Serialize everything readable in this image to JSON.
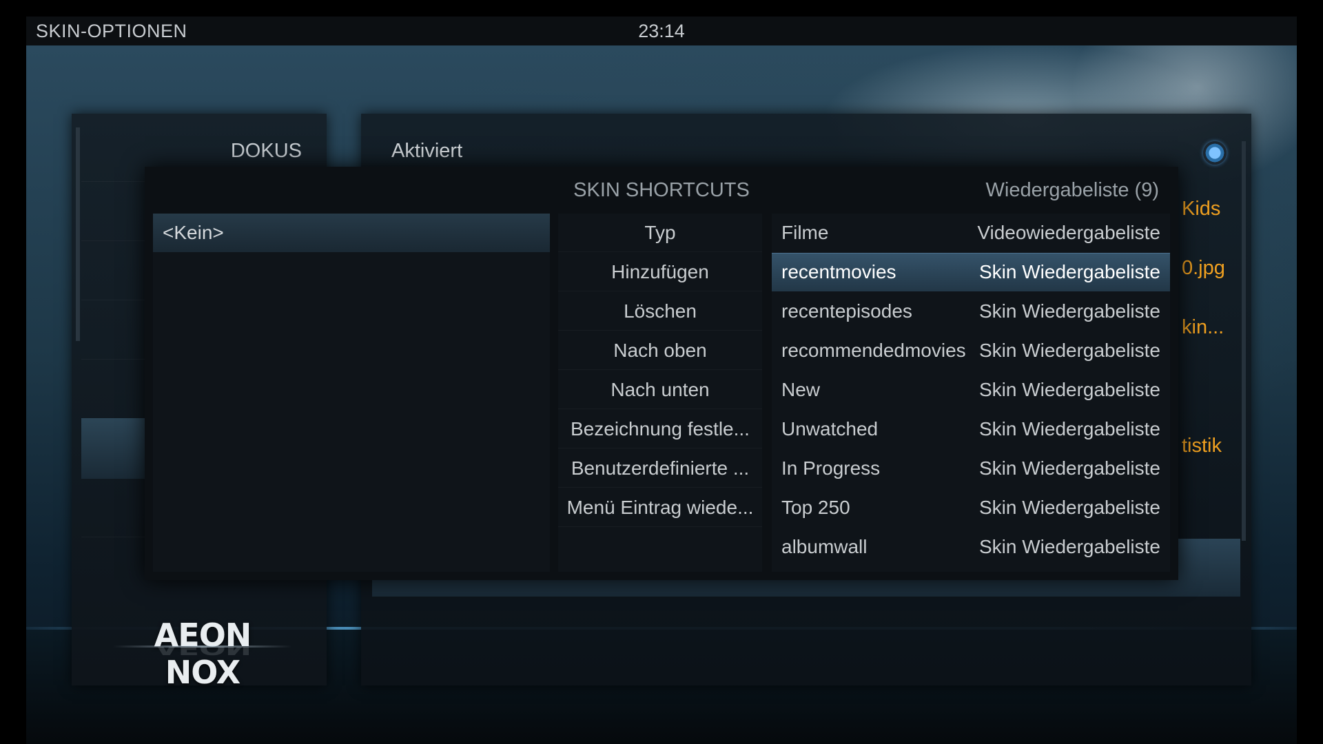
{
  "header": {
    "title": "SKIN-OPTIONEN",
    "clock": "23:14"
  },
  "left_panel": {
    "title": "DOKUS",
    "logo": "AEON NOX"
  },
  "right_panel": {
    "title": "Aktiviert",
    "radio_on": true,
    "values": [
      "Kids",
      "0.jpg",
      "kin...",
      "tistik"
    ]
  },
  "dialog": {
    "title": "SKIN SHORTCUTS",
    "subtitle": "Wiedergabeliste (9)",
    "items": [
      "<Kein>"
    ],
    "actions": [
      "Typ",
      "Hinzufügen",
      "Löschen",
      "Nach oben",
      "Nach unten",
      "Bezeichnung festle...",
      "Benutzerdefinierte ...",
      "Menü Eintrag wiede..."
    ],
    "options": [
      {
        "name": "Filme",
        "type": "Videowiedergabeliste"
      },
      {
        "name": "recentmovies",
        "type": "Skin Wiedergabeliste"
      },
      {
        "name": "recentepisodes",
        "type": "Skin Wiedergabeliste"
      },
      {
        "name": "recommendedmovies",
        "type": "Skin Wiedergabeliste"
      },
      {
        "name": "New",
        "type": "Skin Wiedergabeliste"
      },
      {
        "name": "Unwatched",
        "type": "Skin Wiedergabeliste"
      },
      {
        "name": "In Progress",
        "type": "Skin Wiedergabeliste"
      },
      {
        "name": "Top 250",
        "type": "Skin Wiedergabeliste"
      },
      {
        "name": "albumwall",
        "type": "Skin Wiedergabeliste"
      }
    ]
  }
}
